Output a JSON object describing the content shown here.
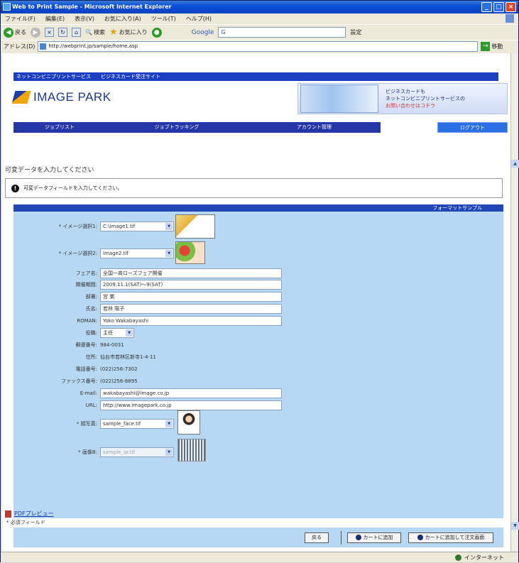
{
  "window": {
    "title": "Web to Print Sample - Microsoft Internet Explorer",
    "buttons": [
      "_",
      "□",
      "×"
    ]
  },
  "menubar": [
    "ファイル(F)",
    "編集(E)",
    "表示(V)",
    "お気に入り(A)",
    "ツール(T)",
    "ヘルプ(H)"
  ],
  "toolbar": {
    "back": "戻る",
    "search": "検索",
    "favorites": "お気に入り",
    "google_label": "Google",
    "google_value": "G",
    "settings": "設定"
  },
  "address": {
    "label": "アドレス(D)",
    "url": "http://webprint.jp/sample/home.asp",
    "go": "移動"
  },
  "site": {
    "top_links": [
      "ネットコンビニプリントサービス",
      "ビジネスカード受注サイト"
    ],
    "logo": "IMAGE PARK",
    "banner_lines": [
      "ビジネスカードも",
      "ネットコンビニプリントサービスの",
      "お問い合わせはコチラ"
    ],
    "nav": [
      "ジョブリスト",
      "ジョブトラッキング",
      "アカウント管理"
    ],
    "logout": "ログアウト"
  },
  "page": {
    "title": "可変データを入力してください",
    "notice": "可変データフィールドを入力してください。",
    "format_sample": "フォーマットサンプル"
  },
  "form": {
    "image1_label": "* イメージ選択1:",
    "image1_value": "C:\\image1.tif",
    "image2_label": "* イメージ選択2:",
    "image2_value": "Image2.tif",
    "event_label": "フェア名:",
    "event_value": "全国一斉ローズフェア開催",
    "period_label": "開催期間:",
    "period_value": "2009.11.1(SAT)〜9(SAT)",
    "dept_label": "部署:",
    "dept_value": "営 業",
    "name_label": "氏名:",
    "name_value": "若林 陽子",
    "roman_label": "ROMAN:",
    "roman_value": "Yoko Wakabayashi",
    "title_label": "役職:",
    "title_value": "主任",
    "zip_label": "郵便番号:",
    "zip_value": "984-0031",
    "addr_label": "住所:",
    "addr_value": "仙台市若林区新寺1-4-11",
    "tel_label": "電話番号:",
    "tel_value": "(022)256-7302",
    "fax_label": "ファックス番号:",
    "fax_value": "(022)256-8895",
    "email_label": "E-mail:",
    "email_value": "wakabayashi@image.co.jp",
    "url_label": "URL:",
    "url_value": "http://www.imagepark.co.jp",
    "photo_label": "* 顔写真:",
    "photo_value": "sample_face.tif",
    "qr_label": "* 画像B:",
    "qr_value": "sample_qr.tif"
  },
  "footer": {
    "pdf_preview": "PDFプレビュー",
    "required_note": "* 必須フィールド",
    "back_button": "戻る",
    "add_cart": "カートに追加",
    "add_cart_order": "カートに追加して注文画面"
  },
  "status": {
    "zone": "インターネット"
  }
}
